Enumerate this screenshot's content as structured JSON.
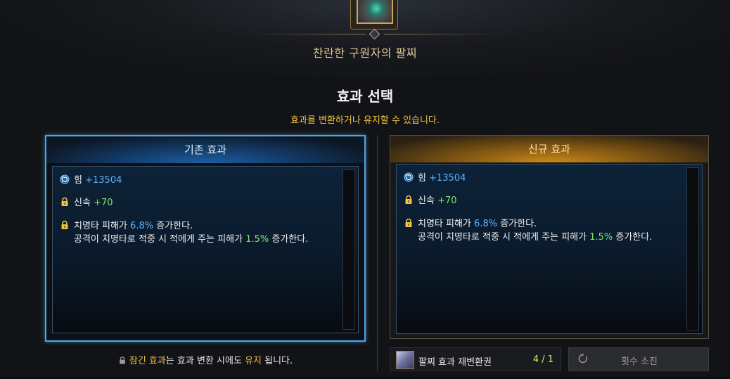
{
  "item": {
    "name": "찬란한 구원자의 팔찌"
  },
  "section": {
    "title": "효과 선택",
    "subtitle": "효과를 변환하거나 유지할 수 있습니다."
  },
  "panels": [
    {
      "header": "기존 효과",
      "lines": [
        {
          "icon": "spiral-icon",
          "label": "힘",
          "value": "+13504"
        },
        {
          "icon": "lock-icon",
          "label": "신속",
          "value": "+70"
        },
        {
          "icon": "lock-icon",
          "text1": "치명타 피해가",
          "value1": "6.8%",
          "text2": "증가한다.",
          "sub_text1": "공격이 치명타로 적중 시 적에게 주는 피해가",
          "sub_value": "1.5%",
          "sub_text2": "증가한다."
        }
      ]
    },
    {
      "header": "신규 효과",
      "lines": [
        {
          "icon": "spiral-icon",
          "label": "힘",
          "value": "+13504"
        },
        {
          "icon": "lock-icon",
          "label": "신속",
          "value": "+70"
        },
        {
          "icon": "lock-icon",
          "text1": "치명타 피해가",
          "value1": "6.8%",
          "text2": "증가한다.",
          "sub_text1": "공격이 치명타로 적중 시 적에게 주는 피해가",
          "sub_value": "1.5%",
          "sub_text2": "증가한다."
        }
      ]
    }
  ],
  "lock_note": {
    "part1": "잠긴 효과",
    "part2": "는 효과 변환 시에도",
    "part3": "유지",
    "part4": "됩니다."
  },
  "reroll": {
    "label": "팔찌 효과 재변환권",
    "count": "4 / 1"
  },
  "exhaust_button": {
    "label": "횟수 소진"
  },
  "colors": {
    "accent_blue": "#5bb6ff",
    "accent_green": "#7fe36b",
    "accent_yellow": "#f2c33f",
    "left_border": "#4fa5e5"
  }
}
